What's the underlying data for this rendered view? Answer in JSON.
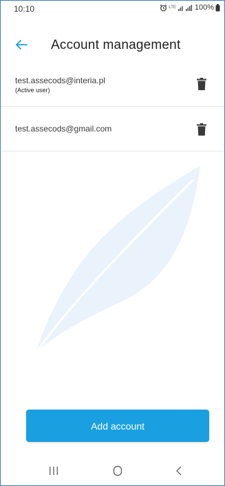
{
  "status_bar": {
    "time": "10:10",
    "network": "LTE",
    "battery": "100%"
  },
  "header": {
    "title": "Account management",
    "back_icon": "arrow-left-icon"
  },
  "accounts": [
    {
      "email": "test.assecods@interia.pl",
      "status": "(Active user)"
    },
    {
      "email": "test.assecods@gmail.com",
      "status": ""
    }
  ],
  "actions": {
    "add_account_label": "Add account"
  },
  "nav_bar": {
    "recents_icon": "recents-icon",
    "home_icon": "home-icon",
    "back_icon": "back-chevron-icon"
  },
  "colors": {
    "accent": "#1aa0e0",
    "watermark": "#eaf3fb",
    "divider": "#e6e6e6"
  }
}
